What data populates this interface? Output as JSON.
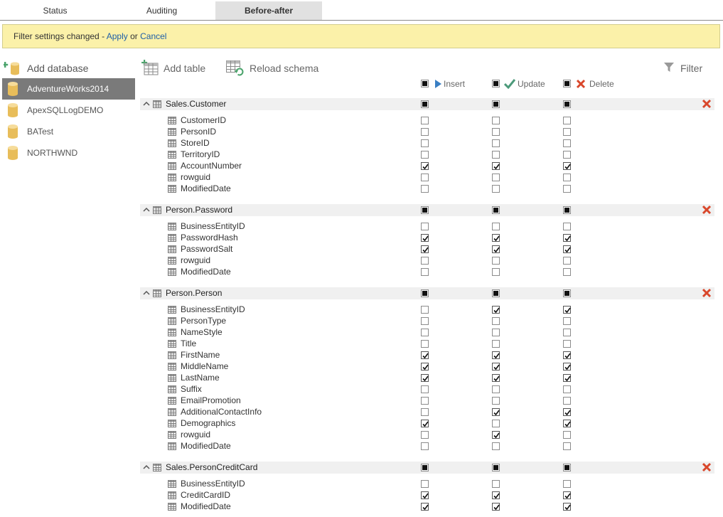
{
  "tabs": [
    {
      "label": "Status",
      "active": false
    },
    {
      "label": "Auditing",
      "active": false
    },
    {
      "label": "Before-after",
      "active": true
    }
  ],
  "banner": {
    "text": "Filter settings changed - ",
    "apply": "Apply",
    "or": " or ",
    "cancel": "Cancel"
  },
  "sidebar": {
    "add_label": "Add database",
    "databases": [
      {
        "name": "AdventureWorks2014",
        "selected": true
      },
      {
        "name": "ApexSQLLogDEMO",
        "selected": false
      },
      {
        "name": "BATest",
        "selected": false
      },
      {
        "name": "NORTHWND",
        "selected": false
      }
    ]
  },
  "toolbar": {
    "add_table": "Add table",
    "reload_schema": "Reload schema",
    "filter": "Filter"
  },
  "headers": {
    "insert": "Insert",
    "update": "Update",
    "delete": "Delete"
  },
  "colors": {
    "accent_link": "#1e5fa8",
    "banner_bg": "#fbf1a9",
    "delete_red": "#d9472b",
    "update_green": "#4c9a7a",
    "insert_blue": "#3a7fc3"
  },
  "tables": [
    {
      "name": "Sales.Customer",
      "columns": [
        {
          "name": "CustomerID",
          "i": false,
          "u": false,
          "d": false
        },
        {
          "name": "PersonID",
          "i": false,
          "u": false,
          "d": false
        },
        {
          "name": "StoreID",
          "i": false,
          "u": false,
          "d": false
        },
        {
          "name": "TerritoryID",
          "i": false,
          "u": false,
          "d": false
        },
        {
          "name": "AccountNumber",
          "i": true,
          "u": true,
          "d": true
        },
        {
          "name": "rowguid",
          "i": false,
          "u": false,
          "d": false
        },
        {
          "name": "ModifiedDate",
          "i": false,
          "u": false,
          "d": false
        }
      ]
    },
    {
      "name": "Person.Password",
      "columns": [
        {
          "name": "BusinessEntityID",
          "i": false,
          "u": false,
          "d": false
        },
        {
          "name": "PasswordHash",
          "i": true,
          "u": true,
          "d": true
        },
        {
          "name": "PasswordSalt",
          "i": true,
          "u": true,
          "d": true
        },
        {
          "name": "rowguid",
          "i": false,
          "u": false,
          "d": false
        },
        {
          "name": "ModifiedDate",
          "i": false,
          "u": false,
          "d": false
        }
      ]
    },
    {
      "name": "Person.Person",
      "columns": [
        {
          "name": "BusinessEntityID",
          "i": false,
          "u": true,
          "d": true
        },
        {
          "name": "PersonType",
          "i": false,
          "u": false,
          "d": false
        },
        {
          "name": "NameStyle",
          "i": false,
          "u": false,
          "d": false
        },
        {
          "name": "Title",
          "i": false,
          "u": false,
          "d": false
        },
        {
          "name": "FirstName",
          "i": true,
          "u": true,
          "d": true
        },
        {
          "name": "MiddleName",
          "i": true,
          "u": true,
          "d": true
        },
        {
          "name": "LastName",
          "i": true,
          "u": true,
          "d": true
        },
        {
          "name": "Suffix",
          "i": false,
          "u": false,
          "d": false
        },
        {
          "name": "EmailPromotion",
          "i": false,
          "u": false,
          "d": false
        },
        {
          "name": "AdditionalContactInfo",
          "i": false,
          "u": true,
          "d": true
        },
        {
          "name": "Demographics",
          "i": true,
          "u": false,
          "d": true
        },
        {
          "name": "rowguid",
          "i": false,
          "u": true,
          "d": false
        },
        {
          "name": "ModifiedDate",
          "i": false,
          "u": false,
          "d": false
        }
      ]
    },
    {
      "name": "Sales.PersonCreditCard",
      "columns": [
        {
          "name": "BusinessEntityID",
          "i": false,
          "u": false,
          "d": false
        },
        {
          "name": "CreditCardID",
          "i": true,
          "u": true,
          "d": true
        },
        {
          "name": "ModifiedDate",
          "i": true,
          "u": true,
          "d": true
        }
      ]
    }
  ]
}
